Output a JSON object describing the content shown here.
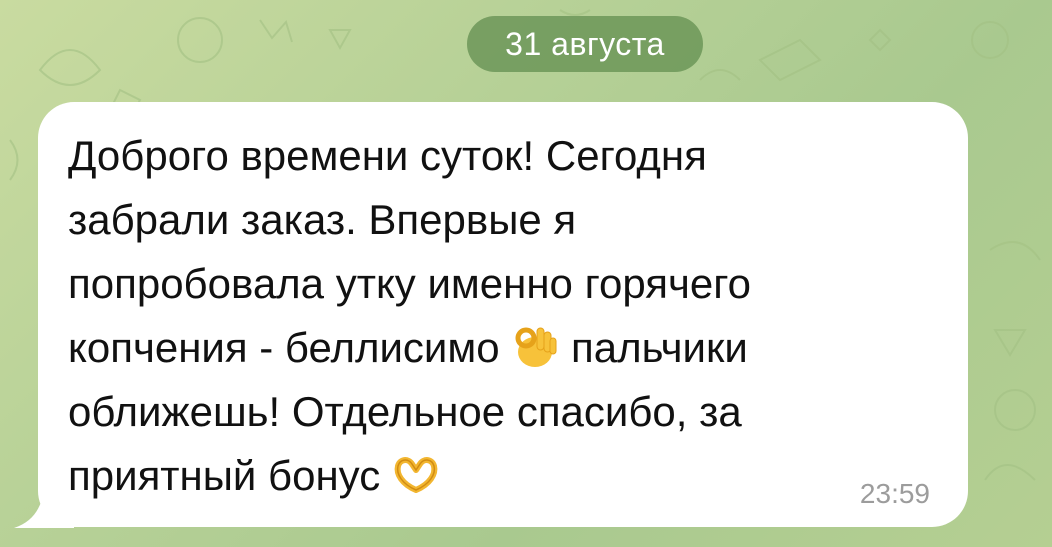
{
  "date_separator": "31 августа",
  "message": {
    "lines": {
      "l1": "Доброго времени суток! Сегодня",
      "l2": "забрали заказ. Впервые я",
      "l3": "попробовала утку именно горячего",
      "l4a": "копчения -  беллисимо",
      "l4b": "пальчики",
      "l5": "оближешь! Отдельное спасибо, за",
      "l6": "приятный бонус"
    },
    "emoji_1": "ok-hand-emoji",
    "emoji_2": "heart-hands-emoji",
    "time": "23:59"
  },
  "colors": {
    "wallpaper": "#b7d197",
    "date_pill": "#6c9658",
    "bubble": "#ffffff",
    "text": "#111111",
    "timestamp": "#9c9c9c"
  }
}
